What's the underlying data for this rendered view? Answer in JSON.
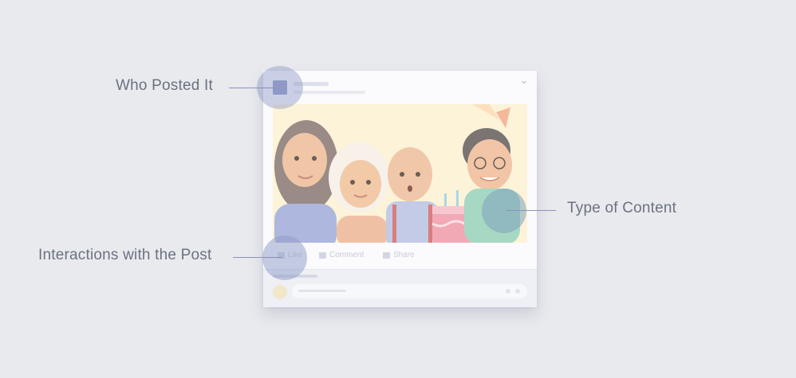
{
  "callouts": {
    "who_posted": "Who Posted It",
    "type_of_content": "Type of Content",
    "interactions": "Interactions with the Post"
  },
  "post": {
    "actions": [
      {
        "label": "Like",
        "icon": "thumbs-up-icon"
      },
      {
        "label": "Comment",
        "icon": "comment-icon"
      },
      {
        "label": "Share",
        "icon": "share-icon"
      }
    ]
  },
  "colors": {
    "background": "#e9eaee",
    "highlight": "#8e99c7",
    "label_text": "#6b7280",
    "leader_line": "#8a93b6"
  }
}
